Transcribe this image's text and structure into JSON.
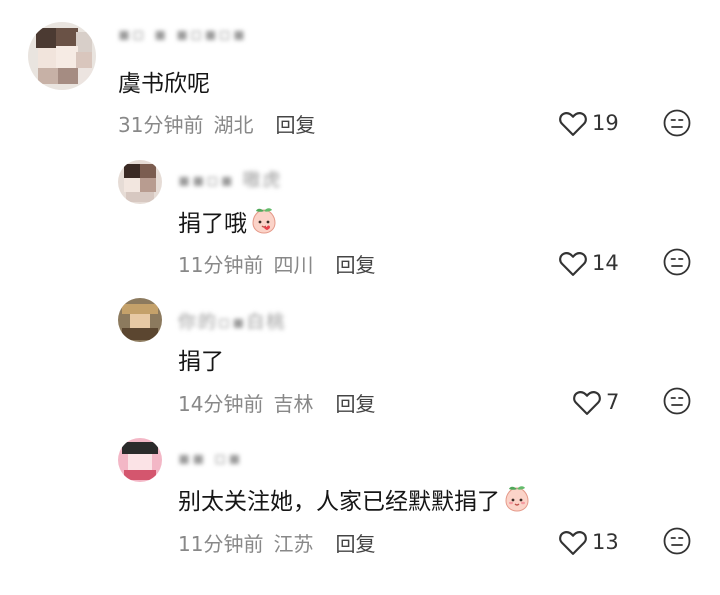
{
  "comments": [
    {
      "username": "▪▫  ▪ ▪▫▪▫▪",
      "text": "虞书欣呢",
      "time": "31分钟前",
      "location": "湖北",
      "reply": "回复",
      "likes": "19"
    },
    {
      "username": "▪▪▫▪ 嗷虎",
      "text": "捐了哦",
      "time": "11分钟前",
      "location": "四川",
      "reply": "回复",
      "likes": "14"
    },
    {
      "username": "你的▫▪白桃",
      "text": "捐了",
      "time": "14分钟前",
      "location": "吉林",
      "reply": "回复",
      "likes": "7"
    },
    {
      "username": "▪▪ ▫▪",
      "text": "别太关注她，人家已经默默捐了",
      "time": "11分钟前",
      "location": "江苏",
      "reply": "回复",
      "likes": "13"
    }
  ],
  "icons": {
    "like": "heart-outline-icon",
    "dislike": "neutral-face-icon",
    "emoji": "peach-face-emoji"
  },
  "colors": {
    "meta": "#888888",
    "reply": "#444444",
    "text": "#161616"
  }
}
